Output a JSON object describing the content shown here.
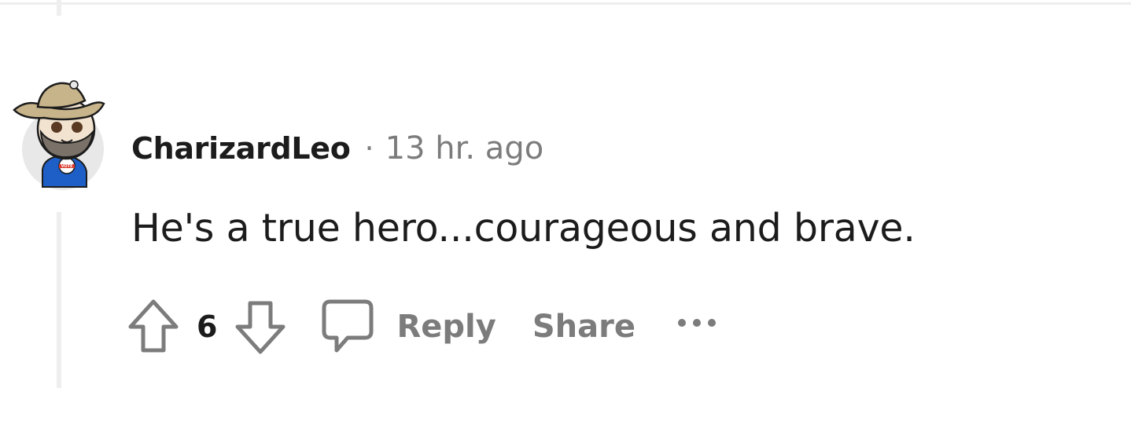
{
  "comment": {
    "author": "CharizardLeo",
    "separator": "·",
    "timestamp": "13 hr. ago",
    "body": "He's a true hero...courageous and brave.",
    "avatar_badge_text": "VOTE"
  },
  "actions": {
    "vote_count": "6",
    "reply_label": "Reply",
    "share_label": "Share"
  },
  "icons": {
    "upvote": "arrow-up-outline-icon",
    "downvote": "arrow-down-outline-icon",
    "comment": "speech-bubble-icon",
    "more": "ellipsis-icon"
  },
  "colors": {
    "text_primary": "#1c1c1c",
    "text_secondary": "#7c7c7c",
    "thread_line": "#eeeeee"
  }
}
